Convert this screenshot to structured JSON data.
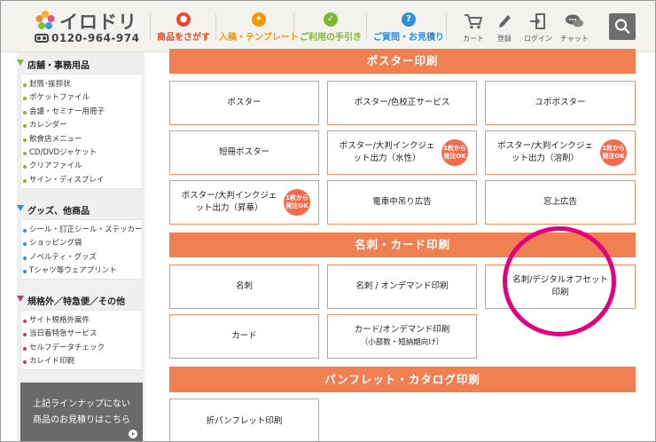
{
  "header": {
    "logo_text": "イロドリ",
    "phone": "0120-964-974",
    "nav": [
      {
        "label": "商品をさがす",
        "color": "#e8452a",
        "icon": "search-icon"
      },
      {
        "label": "入稿・テンプレート",
        "color": "#f39800",
        "icon": "lightbulb-icon"
      },
      {
        "label": "ご利用の手引き",
        "color": "#7cb82f",
        "icon": "guide-icon"
      },
      {
        "label": "ご質問・お見積り",
        "color": "#2f8fd8",
        "icon": "question-icon"
      }
    ],
    "tools": [
      {
        "label": "カート",
        "icon": "cart-icon"
      },
      {
        "label": "登録",
        "icon": "pencil-icon"
      },
      {
        "label": "ログイン",
        "icon": "login-icon"
      },
      {
        "label": "チャット",
        "icon": "chat-icon"
      }
    ]
  },
  "sidebar": {
    "sections": [
      {
        "title": "店舗・事務用品",
        "color": "#7cb82f",
        "items": [
          "封筒･挨拶状",
          "ポケットファイル",
          "会議・セミナー用冊子",
          "カレンダー",
          "飲食店メニュー",
          "CD/DVDジャケット",
          "クリアファイル",
          "サイン・ディスプレイ"
        ]
      },
      {
        "title": "グッズ、他商品",
        "color": "#2f8fd8",
        "items": [
          "シール・訂正シール・ステッカー",
          "ショッピング袋",
          "ノベルティ・グッズ",
          "Tシャツ等ウェアプリント"
        ]
      },
      {
        "title": "規格外／特急便／その他",
        "color": "#c0357a",
        "items": [
          "サイト規格外案件",
          "当日着特急サービス",
          "セルフデータチェック",
          "カレイド印刷"
        ]
      }
    ],
    "quote_line1": "上記ラインナップにない",
    "quote_line2": "商品のお見積りはこちら"
  },
  "main": {
    "sections": [
      {
        "title": "ポスター印刷",
        "cards": [
          {
            "label": "ポスター"
          },
          {
            "label": "ポスター/色校正サービス"
          },
          {
            "label": "ユポポスター"
          },
          {
            "label": "短冊ポスター"
          },
          {
            "label": "ポスター/大判インクジェット出力（水性）",
            "badge": "1枚から発注OK"
          },
          {
            "label": "ポスター/大判インクジェット出力（溶剤）",
            "badge": "1枚から発注OK"
          },
          {
            "label": "ポスター/大判インクジェット出力（昇華）",
            "badge": "1枚から発注OK"
          },
          {
            "label": "電車中吊り広告"
          },
          {
            "label": "窓上広告"
          }
        ]
      },
      {
        "title": "名刺・カード印刷",
        "cards": [
          {
            "label": "名刺"
          },
          {
            "label": "名刺 / オンデマンド印刷"
          },
          {
            "label": "名刺/デジタルオフセット印刷"
          },
          {
            "label": "カード"
          },
          {
            "label": "カード/オンデマンド印刷",
            "sub": "（小部数・短納期向け）"
          }
        ]
      },
      {
        "title": "パンフレット・カタログ印刷",
        "cards": [
          {
            "label": "折パンフレット印刷"
          }
        ]
      }
    ]
  },
  "colors": {
    "accent": "#f07f52",
    "card_border": "#f0906a",
    "badge": "#f56a4d",
    "highlight": "#e3007f"
  }
}
